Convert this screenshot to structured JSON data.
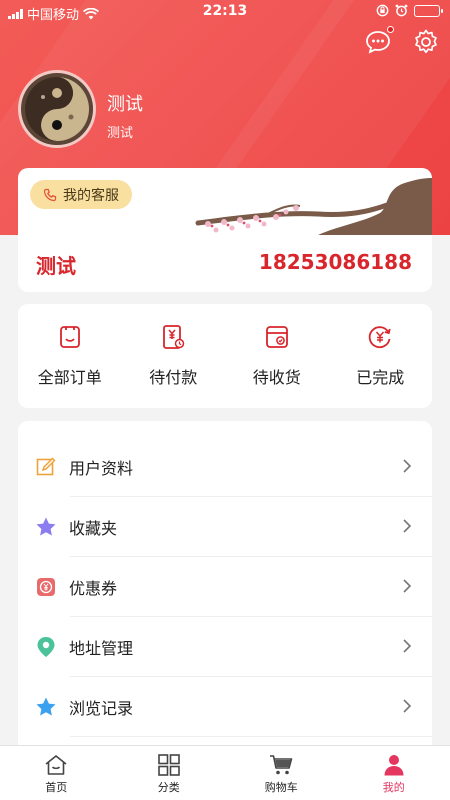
{
  "status_bar": {
    "carrier": "中国移动",
    "time": "22:13"
  },
  "profile": {
    "name": "测试",
    "subtitle": "测试"
  },
  "service": {
    "label": "我的客服"
  },
  "contact": {
    "name": "测试",
    "phone": "18253086188"
  },
  "orders": [
    {
      "label": "全部订单",
      "icon": "order-list-icon"
    },
    {
      "label": "待付款",
      "icon": "pending-payment-icon"
    },
    {
      "label": "待收货",
      "icon": "pending-delivery-icon"
    },
    {
      "label": "已完成",
      "icon": "completed-icon"
    }
  ],
  "menu": [
    {
      "label": "用户资料",
      "icon": "edit-profile-icon",
      "color": "#f0a23a"
    },
    {
      "label": "收藏夹",
      "icon": "star-icon",
      "color": "#8b7cf0"
    },
    {
      "label": "优惠券",
      "icon": "coupon-icon",
      "color": "#e86b6b"
    },
    {
      "label": "地址管理",
      "icon": "location-pin-icon",
      "color": "#4cc29a"
    },
    {
      "label": "浏览记录",
      "icon": "star-icon",
      "color": "#3aa0f0"
    }
  ],
  "tabbar": [
    {
      "label": "首页",
      "icon": "home-icon"
    },
    {
      "label": "分类",
      "icon": "category-icon"
    },
    {
      "label": "购物车",
      "icon": "cart-icon"
    },
    {
      "label": "我的",
      "icon": "user-icon",
      "active": true
    }
  ],
  "colors": {
    "brand_red": "#ef4b4a",
    "accent_text": "#d8262c",
    "active_tab": "#e5365f",
    "service_pill": "#f9e0a0"
  }
}
